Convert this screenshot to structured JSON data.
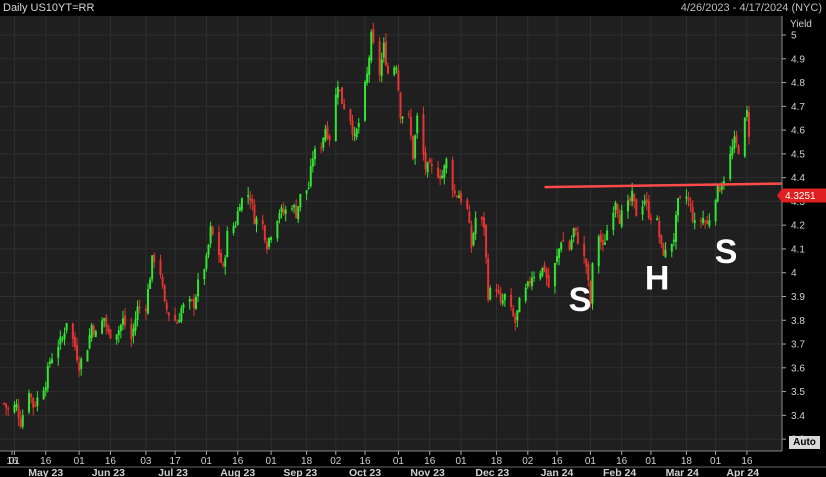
{
  "header": {
    "title": "Daily US10YT=RR",
    "date_range": "4/26/2023 - 4/17/2024 (NYC)"
  },
  "auto_button": "Auto",
  "colors": {
    "up": "#33e633",
    "down": "#e63333",
    "resistance": "#ff4a4a",
    "last_price_bg": "#e02020",
    "plot_bg": "#1e1f1e",
    "grid": "#2e2f2e"
  },
  "chart_data": {
    "type": "candlestick",
    "y_axis": {
      "label": "Yield",
      "position": "right",
      "ylim": [
        3.25,
        5.08
      ],
      "ticks": [
        "3.3",
        "3.4",
        "3.5",
        "3.6",
        "3.7",
        "3.8",
        "3.9",
        "4",
        "4.1",
        "4.2",
        "4.3",
        "4.4",
        "4.5",
        "4.6",
        "4.7",
        "4.8",
        "4.9",
        "5"
      ]
    },
    "x_axis": {
      "xlim": [
        "2023-04-26",
        "2024-04-17"
      ],
      "day_ticks": [
        {
          "label": "16",
          "date": "2023-04-16"
        },
        {
          "label": "01",
          "date": "2023-05-01"
        },
        {
          "label": "16",
          "date": "2023-05-16"
        },
        {
          "label": "01",
          "date": "2023-06-01"
        },
        {
          "label": "16",
          "date": "2023-06-16"
        },
        {
          "label": "03",
          "date": "2023-07-03"
        },
        {
          "label": "17",
          "date": "2023-07-17"
        },
        {
          "label": "01",
          "date": "2023-08-01"
        },
        {
          "label": "16",
          "date": "2023-08-16"
        },
        {
          "label": "01",
          "date": "2023-09-01"
        },
        {
          "label": "18",
          "date": "2023-09-18"
        },
        {
          "label": "02",
          "date": "2023-10-02"
        },
        {
          "label": "16",
          "date": "2023-10-16"
        },
        {
          "label": "01",
          "date": "2023-11-01"
        },
        {
          "label": "16",
          "date": "2023-11-16"
        },
        {
          "label": "01",
          "date": "2023-12-01"
        },
        {
          "label": "18",
          "date": "2023-12-18"
        },
        {
          "label": "02",
          "date": "2024-01-02"
        },
        {
          "label": "16",
          "date": "2024-01-16"
        },
        {
          "label": "01",
          "date": "2024-02-01"
        },
        {
          "label": "16",
          "date": "2024-02-16"
        },
        {
          "label": "01",
          "date": "2024-03-01"
        },
        {
          "label": "18",
          "date": "2024-03-18"
        },
        {
          "label": "01",
          "date": "2024-04-01"
        },
        {
          "label": "16",
          "date": "2024-04-16"
        }
      ],
      "month_labels": [
        {
          "label": "May 23",
          "date": "2023-05-16"
        },
        {
          "label": "Jun 23",
          "date": "2023-06-15"
        },
        {
          "label": "Jul 23",
          "date": "2023-07-16"
        },
        {
          "label": "Aug 23",
          "date": "2023-08-16"
        },
        {
          "label": "Sep 23",
          "date": "2023-09-15"
        },
        {
          "label": "Oct 23",
          "date": "2023-10-16"
        },
        {
          "label": "Nov 23",
          "date": "2023-11-15"
        },
        {
          "label": "Dec 23",
          "date": "2023-12-16"
        },
        {
          "label": "Jan 24",
          "date": "2024-01-16"
        },
        {
          "label": "Feb 24",
          "date": "2024-02-15"
        },
        {
          "label": "Mar 24",
          "date": "2024-03-16"
        },
        {
          "label": "Apr 24",
          "date": "2024-04-14"
        }
      ]
    },
    "close_path": [
      [
        "2023-04-26",
        3.45
      ],
      [
        "2023-04-28",
        3.42
      ],
      [
        "2023-05-02",
        3.44
      ],
      [
        "2023-05-04",
        3.37
      ],
      [
        "2023-05-08",
        3.51
      ],
      [
        "2023-05-10",
        3.44
      ],
      [
        "2023-05-12",
        3.47
      ],
      [
        "2023-05-16",
        3.54
      ],
      [
        "2023-05-18",
        3.63
      ],
      [
        "2023-05-22",
        3.7
      ],
      [
        "2023-05-24",
        3.72
      ],
      [
        "2023-05-26",
        3.8
      ],
      [
        "2023-05-30",
        3.69
      ],
      [
        "2023-06-01",
        3.61
      ],
      [
        "2023-06-05",
        3.69
      ],
      [
        "2023-06-07",
        3.78
      ],
      [
        "2023-06-09",
        3.74
      ],
      [
        "2023-06-13",
        3.81
      ],
      [
        "2023-06-15",
        3.74
      ],
      [
        "2023-06-20",
        3.76
      ],
      [
        "2023-06-22",
        3.8
      ],
      [
        "2023-06-26",
        3.72
      ],
      [
        "2023-06-29",
        3.85
      ],
      [
        "2023-07-03",
        3.86
      ],
      [
        "2023-07-06",
        4.05
      ],
      [
        "2023-07-07",
        4.06
      ],
      [
        "2023-07-10",
        4.0
      ],
      [
        "2023-07-12",
        3.86
      ],
      [
        "2023-07-14",
        3.83
      ],
      [
        "2023-07-18",
        3.79
      ],
      [
        "2023-07-20",
        3.85
      ],
      [
        "2023-07-24",
        3.87
      ],
      [
        "2023-07-26",
        3.87
      ],
      [
        "2023-07-28",
        3.95
      ],
      [
        "2023-08-01",
        4.05
      ],
      [
        "2023-08-03",
        4.18
      ],
      [
        "2023-08-07",
        4.08
      ],
      [
        "2023-08-09",
        4.01
      ],
      [
        "2023-08-11",
        4.16
      ],
      [
        "2023-08-15",
        4.21
      ],
      [
        "2023-08-17",
        4.3
      ],
      [
        "2023-08-21",
        4.33
      ],
      [
        "2023-08-22",
        4.32
      ],
      [
        "2023-08-24",
        4.23
      ],
      [
        "2023-08-28",
        4.2
      ],
      [
        "2023-08-30",
        4.12
      ],
      [
        "2023-09-01",
        4.17
      ],
      [
        "2023-09-05",
        4.26
      ],
      [
        "2023-09-07",
        4.25
      ],
      [
        "2023-09-11",
        4.29
      ],
      [
        "2023-09-13",
        4.25
      ],
      [
        "2023-09-15",
        4.32
      ],
      [
        "2023-09-19",
        4.36
      ],
      [
        "2023-09-21",
        4.49
      ],
      [
        "2023-09-25",
        4.54
      ],
      [
        "2023-09-27",
        4.61
      ],
      [
        "2023-09-29",
        4.57
      ],
      [
        "2023-10-03",
        4.8
      ],
      [
        "2023-10-05",
        4.72
      ],
      [
        "2023-10-09",
        4.65
      ],
      [
        "2023-10-11",
        4.56
      ],
      [
        "2023-10-13",
        4.63
      ],
      [
        "2023-10-17",
        4.83
      ],
      [
        "2023-10-19",
        4.99
      ],
      [
        "2023-10-23",
        4.84
      ],
      [
        "2023-10-25",
        4.95
      ],
      [
        "2023-10-27",
        4.84
      ],
      [
        "2023-10-31",
        4.88
      ],
      [
        "2023-11-02",
        4.67
      ],
      [
        "2023-11-06",
        4.65
      ],
      [
        "2023-11-08",
        4.49
      ],
      [
        "2023-11-10",
        4.65
      ],
      [
        "2023-11-14",
        4.44
      ],
      [
        "2023-11-16",
        4.44
      ],
      [
        "2023-11-20",
        4.42
      ],
      [
        "2023-11-22",
        4.41
      ],
      [
        "2023-11-24",
        4.47
      ],
      [
        "2023-11-28",
        4.33
      ],
      [
        "2023-11-30",
        4.33
      ],
      [
        "2023-12-04",
        4.26
      ],
      [
        "2023-12-06",
        4.11
      ],
      [
        "2023-12-08",
        4.23
      ],
      [
        "2023-12-12",
        4.2
      ],
      [
        "2023-12-14",
        3.91
      ],
      [
        "2023-12-18",
        3.94
      ],
      [
        "2023-12-20",
        3.86
      ],
      [
        "2023-12-22",
        3.9
      ],
      [
        "2023-12-27",
        3.79
      ],
      [
        "2023-12-29",
        3.87
      ],
      [
        "2024-01-02",
        3.94
      ],
      [
        "2024-01-04",
        3.99
      ],
      [
        "2024-01-08",
        4.01
      ],
      [
        "2024-01-10",
        4.02
      ],
      [
        "2024-01-12",
        3.94
      ],
      [
        "2024-01-16",
        4.06
      ],
      [
        "2024-01-18",
        4.14
      ],
      [
        "2024-01-22",
        4.1
      ],
      [
        "2024-01-24",
        4.18
      ],
      [
        "2024-01-26",
        4.14
      ],
      [
        "2024-01-30",
        4.03
      ],
      [
        "2024-02-01",
        3.87
      ],
      [
        "2024-02-02",
        4.02
      ],
      [
        "2024-02-05",
        4.16
      ],
      [
        "2024-02-07",
        4.1
      ],
      [
        "2024-02-09",
        4.18
      ],
      [
        "2024-02-13",
        4.31
      ],
      [
        "2024-02-15",
        4.23
      ],
      [
        "2024-02-19",
        4.28
      ],
      [
        "2024-02-21",
        4.32
      ],
      [
        "2024-02-23",
        4.25
      ],
      [
        "2024-02-27",
        4.31
      ],
      [
        "2024-02-29",
        4.25
      ],
      [
        "2024-03-04",
        4.21
      ],
      [
        "2024-03-06",
        4.1
      ],
      [
        "2024-03-08",
        4.08
      ],
      [
        "2024-03-12",
        4.15
      ],
      [
        "2024-03-14",
        4.29
      ],
      [
        "2024-03-18",
        4.32
      ],
      [
        "2024-03-20",
        4.27
      ],
      [
        "2024-03-22",
        4.2
      ],
      [
        "2024-03-26",
        4.23
      ],
      [
        "2024-03-28",
        4.2
      ],
      [
        "2024-04-01",
        4.33
      ],
      [
        "2024-04-03",
        4.36
      ],
      [
        "2024-04-05",
        4.4
      ],
      [
        "2024-04-10",
        4.55
      ],
      [
        "2024-04-12",
        4.52
      ],
      [
        "2024-04-16",
        4.67
      ],
      [
        "2024-04-17",
        4.59
      ]
    ],
    "last_price_label": {
      "text": "4.3251",
      "value": 4.3251
    },
    "resistance_line": {
      "from": [
        "2024-01-10",
        4.36
      ],
      "to": [
        "2024-04-17",
        4.375
      ]
    },
    "annotations": [
      {
        "text": "S",
        "date": "2024-01-27",
        "y": 3.84
      },
      {
        "text": "H",
        "date": "2024-03-04",
        "y": 3.93
      },
      {
        "text": "S",
        "date": "2024-04-06",
        "y": 4.04
      }
    ]
  }
}
